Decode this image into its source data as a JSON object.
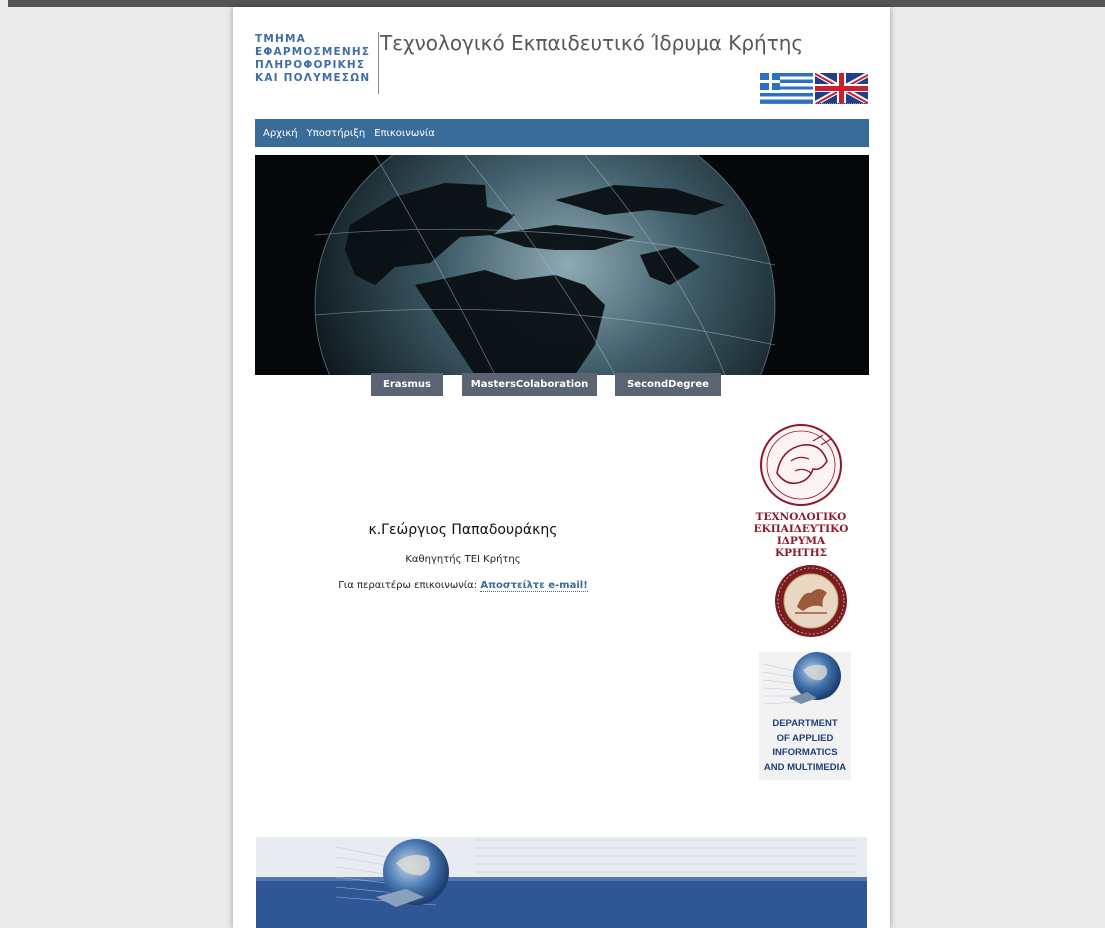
{
  "header": {
    "dept_lines": [
      "ΤΜΗΜΑ",
      "ΕΦΑΡΜΟΣΜΕΝΗΣ",
      "ΠΛΗΡΟΦΟΡΙΚΗΣ",
      "ΚΑΙ ΠΟΛΥΜΕΣΩΝ"
    ],
    "institution_title": "Τεχνολογικό Εκπαιδευτικό Ίδρυμα Κρήτης",
    "flags": [
      {
        "name": "greek-flag-icon",
        "language": "el"
      },
      {
        "name": "uk-flag-icon",
        "language": "en"
      }
    ]
  },
  "nav": {
    "items": [
      {
        "label": "Αρχική"
      },
      {
        "label": "Υποστήριξη"
      },
      {
        "label": "Επικοινωνία"
      }
    ]
  },
  "tabs": [
    {
      "label": "Erasmus"
    },
    {
      "label": "MastersColaboration"
    },
    {
      "label": "SecondDegree"
    }
  ],
  "person": {
    "name": "κ.Γεώργιος Παπαδουράκης",
    "role": "Καθηγητής ΤΕΙ Κρήτης",
    "contact_prefix": "Για περαιτέρω επικοινωνία:",
    "email_link": "Αποστείλτε e-mail!"
  },
  "logos": {
    "tei_lines": [
      "ΤΕΧΝΟΛΟΓΙΚΟ",
      "ΕΚΠΑΙΔΕΥΤΙΚΟ",
      "ΙΔΡΥΜΑ ΚΡΗΤΗΣ"
    ],
    "dept_lines": [
      "DEPARTMENT",
      "OF APPLIED",
      "INFORMATICS",
      "AND MULTIMEDIA"
    ]
  },
  "colors": {
    "nav_bar": "#3a6c9a",
    "tab": "#5b6472",
    "dept_text": "#3f6ea6",
    "tei_logo": "#8b1a2b",
    "link": "#3a6c9a"
  }
}
